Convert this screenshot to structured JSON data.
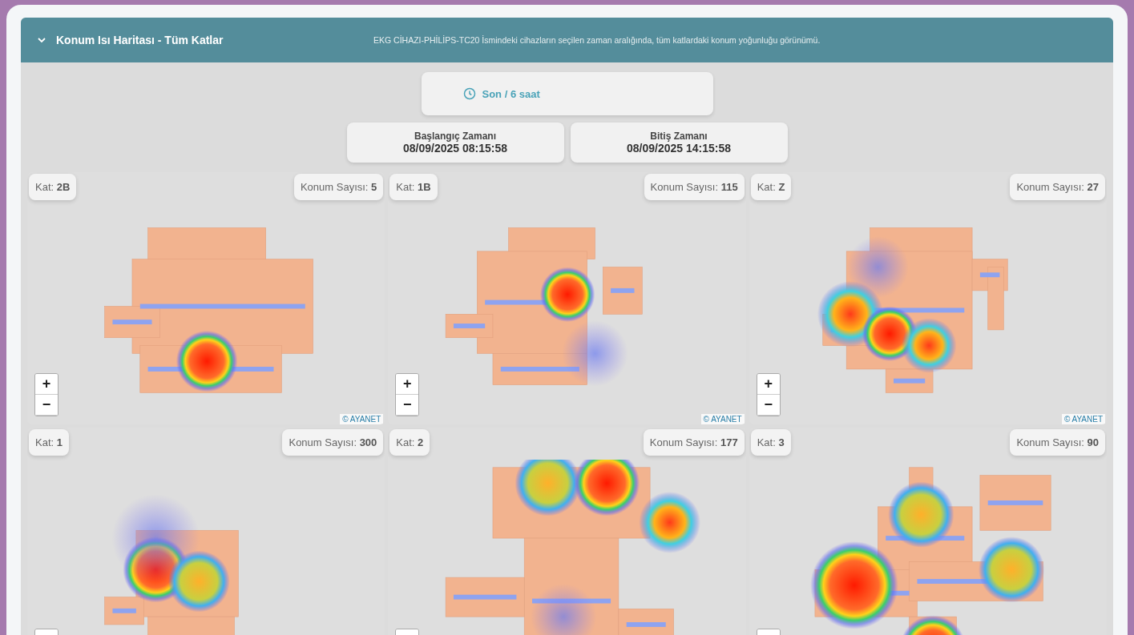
{
  "header": {
    "title": "Konum Isı Haritası - Tüm Katlar",
    "expanded": true,
    "description": "EKG CİHAZI-PHİLİPS-TC20 İsmindeki cihazların seçilen zaman aralığında, tüm katlardaki konum yoğunluğu görünümü."
  },
  "range": {
    "label": "Son / 6 saat"
  },
  "times": [
    {
      "label": "Başlangıç Zamanı",
      "value": "08/09/2025 08:15:58"
    },
    {
      "label": "Bitiş Zamanı",
      "value": "08/09/2025 14:15:58"
    }
  ],
  "maps": [
    {
      "floor_label": "Kat:",
      "floor": "2B",
      "count_label": "Konum Sayısı:",
      "count": "5"
    },
    {
      "floor_label": "Kat:",
      "floor": "1B",
      "count_label": "Konum Sayısı:",
      "count": "115"
    },
    {
      "floor_label": "Kat:",
      "floor": "Z",
      "count_label": "Konum Sayısı:",
      "count": "27"
    },
    {
      "floor_label": "Kat:",
      "floor": "1",
      "count_label": "Konum Sayısı:",
      "count": "300"
    },
    {
      "floor_label": "Kat:",
      "floor": "2",
      "count_label": "Konum Sayısı:",
      "count": "177"
    },
    {
      "floor_label": "Kat:",
      "floor": "3",
      "count_label": "Konum Sayısı:",
      "count": "90"
    }
  ],
  "map_controls": {
    "zoom_in": "+",
    "zoom_out": "−"
  },
  "attributions": [
    {
      "symbol": "©",
      "text": "AYANET"
    },
    {
      "symbol": "©",
      "text": "AYANET"
    },
    {
      "symbol": "©",
      "text": "AYANET"
    }
  ]
}
